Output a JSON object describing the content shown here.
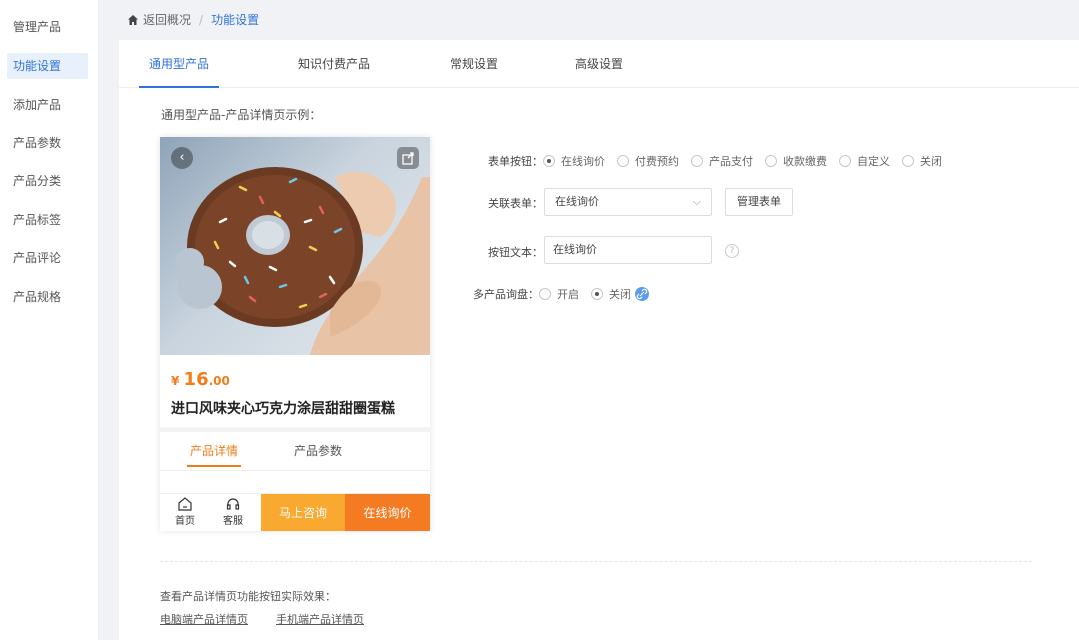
{
  "sidebar": {
    "items": [
      {
        "label": "管理产品"
      },
      {
        "label": "功能设置"
      },
      {
        "label": "添加产品"
      },
      {
        "label": "产品参数"
      },
      {
        "label": "产品分类"
      },
      {
        "label": "产品标签"
      },
      {
        "label": "产品评论"
      },
      {
        "label": "产品规格"
      }
    ],
    "active_index": 1
  },
  "breadcrumb": {
    "back": "返回概况",
    "separator": "/",
    "current": "功能设置"
  },
  "tabs": [
    {
      "label": "通用型产品"
    },
    {
      "label": "知识付费产品"
    },
    {
      "label": "常规设置"
    },
    {
      "label": "高级设置"
    }
  ],
  "active_tab": 0,
  "section_title": "通用型产品-产品详情页示例：",
  "preview": {
    "back_icon": "chevron-left-icon",
    "share_icon": "share-icon",
    "price_currency": "¥",
    "price_int": "16",
    "price_dec": ".00",
    "product_name": "进口风味夹心巧克力涂层甜甜圈蛋糕",
    "tabs": [
      {
        "label": "产品详情"
      },
      {
        "label": "产品参数"
      }
    ],
    "bottom": {
      "home_label": "首页",
      "service_label": "客服",
      "consult_label": "马上咨询",
      "inquiry_label": "在线询价"
    },
    "colors": {
      "accent": "#f07d1a",
      "consult": "#f9a830",
      "inquiry": "#f47b21"
    }
  },
  "form": {
    "button_type": {
      "label": "表单按钮：",
      "options": [
        "在线询价",
        "付费预约",
        "产品支付",
        "收款缴费",
        "自定义",
        "关闭"
      ],
      "selected": "在线询价"
    },
    "linked_form": {
      "label": "关联表单：",
      "value": "在线询价",
      "manage_button": "管理表单"
    },
    "button_text": {
      "label": "按钮文本：",
      "value": "在线询价",
      "help": "?"
    },
    "multi_inquiry": {
      "label": "多产品询盘：",
      "options": [
        "开启",
        "关闭"
      ],
      "selected": "关闭"
    }
  },
  "footer": {
    "title": "查看产品详情页功能按钮实际效果：",
    "links": [
      "电脑端产品详情页",
      "手机端产品详情页"
    ]
  },
  "colors": {
    "primary": "#2f73d9",
    "page_bg": "#f0f2f5"
  }
}
